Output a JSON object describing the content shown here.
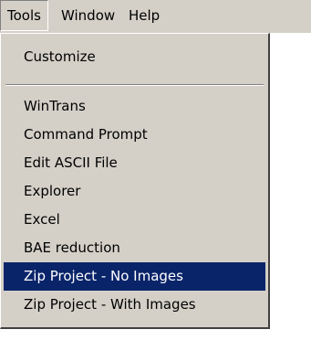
{
  "menubar": {
    "items": [
      {
        "label": "Tools"
      },
      {
        "label": "Window"
      },
      {
        "label": "Help"
      }
    ]
  },
  "tools_menu": {
    "items": [
      {
        "label": "Customize"
      },
      {
        "label": "WinTrans"
      },
      {
        "label": "Command Prompt"
      },
      {
        "label": "Edit ASCII File"
      },
      {
        "label": "Explorer"
      },
      {
        "label": "Excel"
      },
      {
        "label": "BAE reduction"
      },
      {
        "label": "Zip Project - No Images",
        "selected": true
      },
      {
        "label": "Zip Project - With Images"
      }
    ]
  },
  "colors": {
    "menu_background": "#d4d0c8",
    "highlight": "#0a246a",
    "highlight_text": "#ffffff"
  }
}
